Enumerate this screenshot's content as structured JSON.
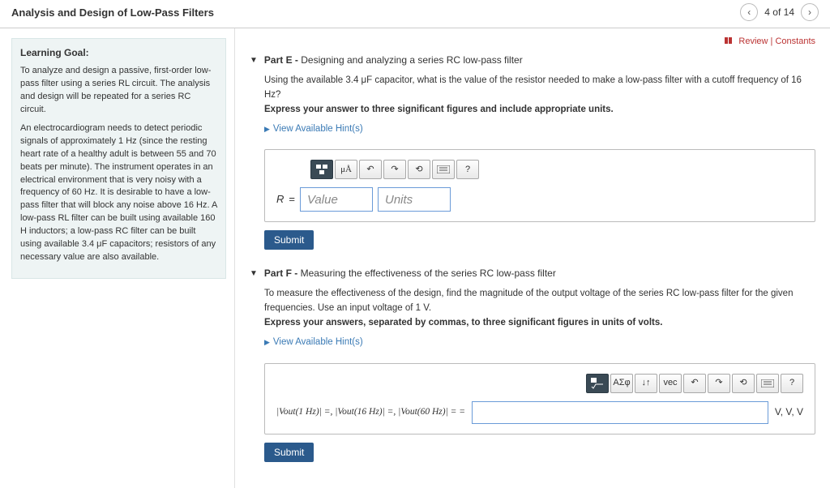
{
  "header": {
    "title": "Analysis and Design of Low-Pass Filters",
    "position": "4 of 14"
  },
  "top_links": {
    "review": "Review",
    "constants": "Constants"
  },
  "sidebar": {
    "goal_title": "Learning Goal:",
    "goal_p1": "To analyze and design a passive, first-order low-pass filter using a series RL circuit. The analysis and design will be repeated for a series RC circuit.",
    "goal_p2": "An electrocardiogram needs to detect periodic signals of approximately 1 Hz (since the resting heart rate of a healthy adult is between 55 and 70 beats per minute). The instrument operates in an electrical environment that is very noisy with a frequency of 60 Hz. It is desirable to have a low-pass filter that will block any noise above 16 Hz. A low-pass RL filter can be built using available 160 H inductors; a low-pass RC filter can be built using available 3.4 μF capacitors; resistors of any necessary value are also available."
  },
  "partE": {
    "title_prefix": "Part E - ",
    "title": "Designing and analyzing a series RC low-pass filter",
    "prompt": "Using the available 3.4 μF capacitor, what is the value of the resistor needed to make a low-pass filter with a cutoff frequency of 16 Hz?",
    "instr": "Express your answer to three significant figures and include appropriate units.",
    "hints": "View Available Hint(s)",
    "var": "R",
    "eq": "=",
    "value_ph": "Value",
    "units_ph": "Units",
    "submit": "Submit",
    "tool_units": "μÅ",
    "tool_help": "?"
  },
  "partF": {
    "title_prefix": "Part F - ",
    "title": "Measuring the effectiveness of the series RC low-pass filter",
    "prompt": "To measure the effectiveness of the design, find the magnitude of the output voltage of the series RC low-pass filter for the given frequencies. Use an input voltage of 1 V.",
    "instr": "Express your answers, separated by commas, to three significant figures in units of volts.",
    "hints": "View Available Hint(s)",
    "lhs": "|Vout(1 Hz)| =, |Vout(16 Hz)| =, |Vout(60 Hz)| = =",
    "units": "V, V, V",
    "submit": "Submit",
    "tool_templates": "ΑΣφ",
    "tool_vec": "vec",
    "tool_help": "?"
  }
}
